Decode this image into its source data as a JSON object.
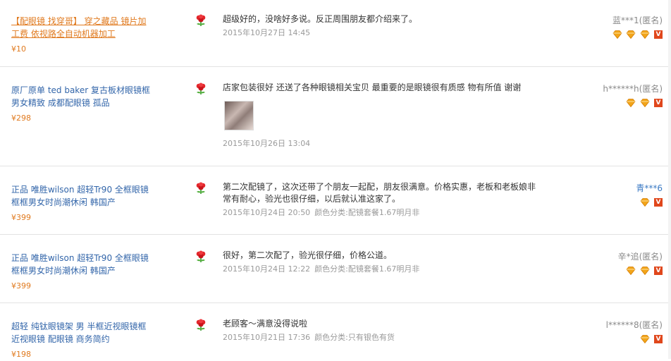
{
  "reviews": [
    {
      "product_title": "【配眼镜 找穿哥】 穿之藏品 镜片加工费 依视路全自动机器加工",
      "price": "¥10",
      "review_text": "超级好的，没啥好多说。反正周围朋友都介绍来了。",
      "date": "2015年10月27日 14:45",
      "sku": "",
      "user": "蓝***1(匿名)",
      "gems": 3,
      "vbadge": true,
      "thumbnail": false,
      "highlight": true
    },
    {
      "product_title": "原厂原单 ted baker 复古板材眼镜框男女精致 成都配眼镜 孤品",
      "price": "¥298",
      "review_text": "店家包装很好 还送了各种眼镜相关宝贝 最重要的是眼镜很有质感 物有所值 谢谢",
      "date": "2015年10月26日 13:04",
      "sku": "",
      "user": "h******h(匿名)",
      "gems": 2,
      "vbadge": true,
      "thumbnail": true,
      "highlight": false
    },
    {
      "product_title": "正品 唯胜wilson 超轻Tr90 全框眼镜框框男女时尚潮休闲 韩国产",
      "price": "¥399",
      "review_text": "第二次配镜了，这次还带了个朋友一起配，朋友很满意。价格实惠，老板和老板娘非常有耐心，验光也很仔细，以后就认准这家了。",
      "date": "2015年10月24日 20:50",
      "sku": "颜色分类:配镜套餐1.67明月非",
      "user": "青***6",
      "gems": 1,
      "vbadge": true,
      "thumbnail": false,
      "highlight": false,
      "vip": true
    },
    {
      "product_title": "正品 唯胜wilson 超轻Tr90 全框眼镜框框男女时尚潮休闲 韩国产",
      "price": "¥399",
      "review_text": "很好，第二次配了，验光很仔细，价格公道。",
      "date": "2015年10月24日 12:22",
      "sku": "颜色分类:配镜套餐1.67明月非",
      "user": "辛*追(匿名)",
      "gems": 2,
      "vbadge": true,
      "thumbnail": false,
      "highlight": false
    },
    {
      "product_title": "超轻 纯钛眼镜架 男 半框近视眼镜框近视眼镜 配眼镜 商务简约",
      "price": "¥198",
      "review_text": "老顾客～满意没得说啦",
      "date": "2015年10月21日 17:36",
      "sku": "颜色分类:只有银色有货",
      "user": "l******8(匿名)",
      "gems": 1,
      "vbadge": true,
      "thumbnail": false,
      "highlight": false
    }
  ],
  "colors": {
    "link": "#3366aa",
    "price": "#e07a1f",
    "meta": "#9a9a9a",
    "vbadge": "#e0471c",
    "gem": "#f2a51a"
  },
  "icons": {
    "rating": "red-flower-icon",
    "gem": "diamond-gem-icon",
    "verified": "v-badge-icon"
  }
}
